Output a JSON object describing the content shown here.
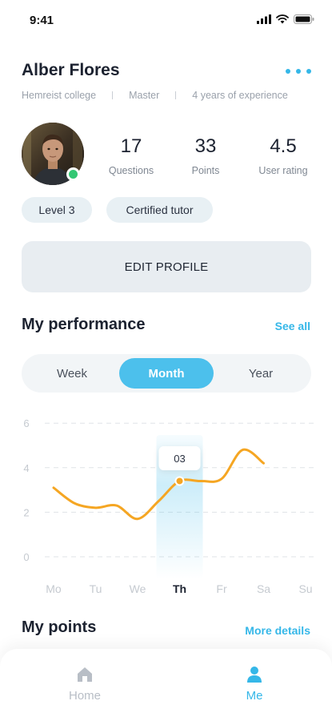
{
  "status_bar": {
    "time": "9:41"
  },
  "profile": {
    "name": "Alber Flores",
    "college": "Hemreist college",
    "degree": "Master",
    "experience": "4 years of experience",
    "stats": [
      {
        "value": "17",
        "label": "Questions"
      },
      {
        "value": "33",
        "label": "Points"
      },
      {
        "value": "4.5",
        "label": "User rating"
      }
    ],
    "chips": [
      "Level 3",
      "Certified tutor"
    ],
    "edit_label": "EDIT PROFILE"
  },
  "performance": {
    "title": "My performance",
    "link": "See all",
    "tabs": [
      "Week",
      "Month",
      "Year"
    ],
    "active_tab": "Month",
    "tooltip": "03"
  },
  "chart_data": {
    "type": "line",
    "categories": [
      "Mo",
      "Tu",
      "We",
      "Th",
      "Fr",
      "Sa",
      "Su"
    ],
    "highlighted_category": "Th",
    "y_ticks": [
      "0",
      "2",
      "4",
      "6"
    ],
    "ylim": [
      0,
      6
    ],
    "grid": true,
    "series": [
      {
        "x": [
          0,
          0.5,
          1,
          1.5,
          2,
          2.5,
          3,
          3.5,
          4,
          4.5,
          5
        ],
        "values": [
          3.1,
          2.4,
          2.2,
          2.3,
          1.7,
          2.5,
          3.4,
          3.4,
          3.5,
          4.8,
          4.2
        ]
      }
    ],
    "highlight_point": {
      "x": 3,
      "y": 3.4
    },
    "colors": {
      "line": "#f5a623",
      "highlight": "#4cc0ec"
    }
  },
  "points": {
    "title": "My points",
    "link": "More details"
  },
  "bottom_nav": {
    "items": [
      {
        "label": "Home",
        "icon": "home-icon",
        "active": false
      },
      {
        "label": "Me",
        "icon": "person-icon",
        "active": true
      }
    ],
    "active_color": "#35b7e8",
    "inactive_color": "#b8bec6"
  }
}
